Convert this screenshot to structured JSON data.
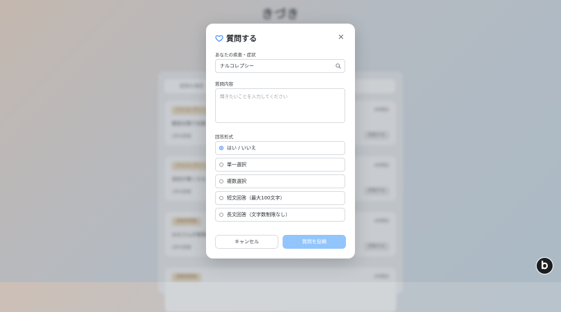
{
  "background": {
    "app_title": "きづき",
    "search_placeholder": "質問を検索",
    "cards": [
      {
        "tag": "ナルコレプシー",
        "date": "4時間前",
        "question": "眠気対策で効果",
        "answers": "2件の回答",
        "button": "回答する"
      },
      {
        "tag": "ナルコレプシー",
        "date": "4時間前",
        "question": "症状が重くなる",
        "answers": "1件の回答",
        "button": "回答する"
      },
      {
        "tag": "双極性障害",
        "date": "4時間前",
        "question": "みなさんが実際に",
        "answers": "2件の回答",
        "button": "回答する"
      },
      {
        "tag": "双極性障害",
        "date": "4時間前",
        "question": "",
        "answers": "",
        "button": ""
      }
    ]
  },
  "modal": {
    "title": "質問する",
    "condition_label": "あなたの疾患・症状",
    "condition_value": "ナルコレプシー",
    "content_label": "質問内容",
    "content_placeholder": "聞きたいことを入力してください",
    "format_label": "回答形式",
    "options": [
      {
        "label": "はい / いいえ",
        "checked": true
      },
      {
        "label": "単一選択",
        "checked": false
      },
      {
        "label": "複数選択",
        "checked": false
      },
      {
        "label": "短文回答（最大100文字）",
        "checked": false
      },
      {
        "label": "長文回答（文字数制限なし）",
        "checked": false
      }
    ],
    "cancel_label": "キャンセル",
    "submit_label": "質問を投稿"
  },
  "colors": {
    "accent": "#3b82f6",
    "submit_disabled": "#93c5fd"
  },
  "icons": {
    "title_icon": "heart-icon",
    "close_icon": "close-icon",
    "search_icon": "search-icon",
    "brand_icon": "brand-logo-icon"
  }
}
